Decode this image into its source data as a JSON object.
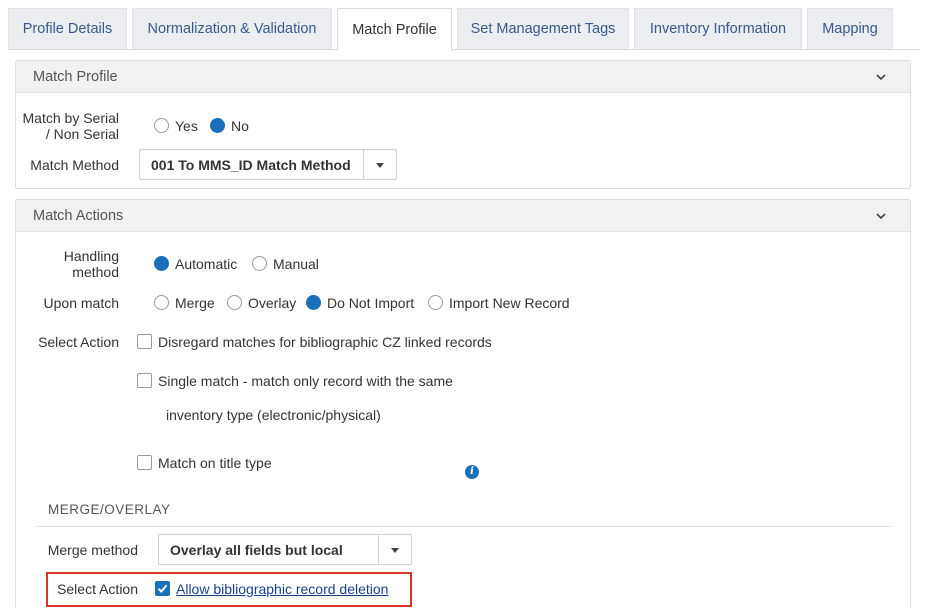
{
  "tabs": [
    {
      "label": "Profile Details"
    },
    {
      "label": "Normalization & Validation"
    },
    {
      "label": "Match Profile"
    },
    {
      "label": "Set Management Tags"
    },
    {
      "label": "Inventory Information"
    },
    {
      "label": "Mapping"
    }
  ],
  "active_tab": "Match Profile",
  "match_profile": {
    "header": "Match Profile",
    "serial_label_1": "Match by Serial",
    "serial_label_2": "/ Non Serial",
    "serial_options": [
      "Yes",
      "No"
    ],
    "serial_selected": "No",
    "method_label": "Match Method",
    "method_value": "001 To MMS_ID Match Method"
  },
  "match_actions": {
    "header": "Match Actions",
    "handling_label_1": "Handling",
    "handling_label_2": "method",
    "handling_options": [
      "Automatic",
      "Manual"
    ],
    "handling_selected": "Automatic",
    "upon_match_label": "Upon match",
    "upon_match_options": [
      "Merge",
      "Overlay",
      "Do Not Import",
      "Import New Record"
    ],
    "upon_match_selected": "Do Not Import",
    "select_action_label": "Select Action",
    "disregard_label": "Disregard matches for bibliographic CZ linked records",
    "single_match_label": "Single match - match only record with the same",
    "single_match_label_2": "inventory type (electronic/physical)",
    "title_type_label": "Match on title type",
    "merge_section_title": "MERGE/OVERLAY",
    "merge_method_label": "Merge method",
    "merge_method_value": "Overlay all fields but local",
    "allow_deletion_action_label": "Select Action",
    "allow_deletion_label": "Allow bibliographic record deletion",
    "allow_deletion_checked": true
  },
  "colors": {
    "accent": "#1a70b8",
    "highlight": "#d9342b",
    "link": "#1a3f8c"
  },
  "icons": [
    "chevron-down-icon",
    "info-icon",
    "checkmark-icon"
  ]
}
